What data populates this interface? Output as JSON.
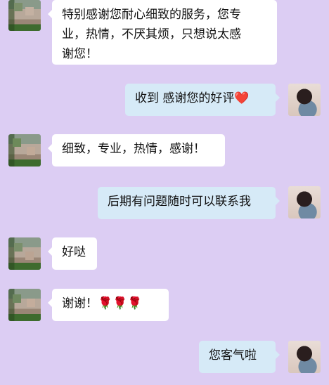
{
  "colors": {
    "background": "#dccdf3",
    "incoming_bubble": "#ffffff",
    "outgoing_bubble": "#d6eaf7"
  },
  "messages": [
    {
      "side": "left",
      "text_line1": "特别感谢您耐心细致的服务，您专",
      "text_line2": "业，热情，不厌其烦，只想说太感",
      "text_line3": "谢您！"
    },
    {
      "side": "right",
      "text": "收到  感谢您的好评",
      "emoji": "❤️"
    },
    {
      "side": "left",
      "text": "细致，专业，热情，感谢！"
    },
    {
      "side": "right",
      "text": "后期有问题随时可以联系我"
    },
    {
      "side": "left",
      "text": "好哒"
    },
    {
      "side": "left",
      "text": "谢谢！",
      "emoji": "🌹🌹🌹"
    },
    {
      "side": "right",
      "text": "您客气啦"
    }
  ]
}
